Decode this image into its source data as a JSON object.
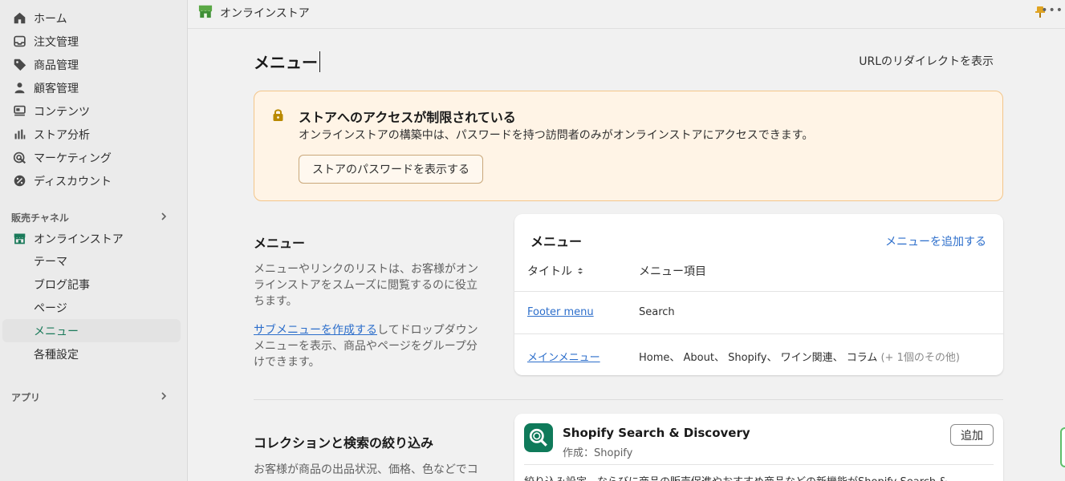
{
  "sidebar": {
    "nav": [
      {
        "label": "ホーム",
        "icon": "home-icon"
      },
      {
        "label": "注文管理",
        "icon": "inbox-icon"
      },
      {
        "label": "商品管理",
        "icon": "tag-icon"
      },
      {
        "label": "顧客管理",
        "icon": "person-icon"
      },
      {
        "label": "コンテンツ",
        "icon": "content-icon"
      },
      {
        "label": "ストア分析",
        "icon": "bar-chart-icon"
      },
      {
        "label": "マーケティング",
        "icon": "target-icon"
      },
      {
        "label": "ディスカウント",
        "icon": "discount-icon"
      }
    ],
    "sales_channels_label": "販売チャネル",
    "online_store": {
      "label": "オンラインストア",
      "icon": "store-icon"
    },
    "sub_items": [
      "テーマ",
      "ブログ記事",
      "ページ",
      "メニュー",
      "各種設定"
    ],
    "active_sub_item": "メニュー",
    "apps_label": "アプリ"
  },
  "topbar": {
    "title": "オンラインストア"
  },
  "page": {
    "title": "メニュー",
    "redirect_link": "URLのリダイレクトを表示"
  },
  "banner": {
    "title": "ストアへのアクセスが制限されている",
    "text": "オンラインストアの構築中は、パスワードを持つ訪問者のみがオンラインストアにアクセスできます。",
    "button": "ストアのパスワードを表示する"
  },
  "menus_section": {
    "heading": "メニュー",
    "desc": "メニューやリンクのリストは、お客様がオンラインストアをスムーズに閲覧するのに役立ちます。",
    "link": "サブメニューを作成する",
    "desc2": "してドロップダウンメニューを表示、商品やページをグループ分けできます。"
  },
  "menus_card": {
    "title": "メニュー",
    "add_link": "メニューを追加する",
    "col_title": "タイトル",
    "col_items": "メニュー項目",
    "rows": [
      {
        "title": "Footer menu",
        "items": "Search",
        "more": ""
      },
      {
        "title": "メインメニュー",
        "items": "Home、 About、 Shopify、 ワイン関連、 コラム",
        "more": "(+ 1個のその他)"
      }
    ]
  },
  "filters_section": {
    "heading": "コレクションと検索の絞り込み",
    "desc": "お客様が商品の出品状況、価格、色などでコ"
  },
  "app_card": {
    "title": "Shopify Search & Discovery",
    "author": "作成：Shopify",
    "button": "追加",
    "desc": "絞り込み設定、ならびに商品の販売促進やおすすめ商品などの新機能がShopify Search &"
  },
  "colors": {
    "accent": "#2c6ecb",
    "brand": "#0f7a5a",
    "banner_bg": "#fff4e6",
    "banner_border": "#f3c58a"
  }
}
